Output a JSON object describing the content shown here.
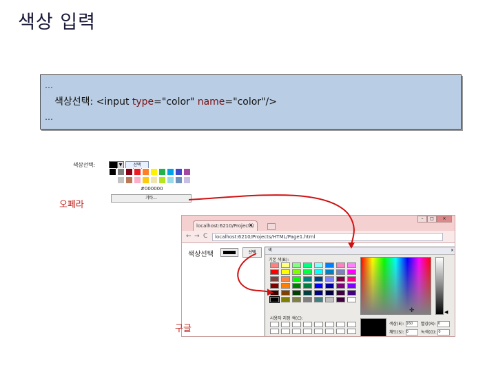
{
  "slide_title": "색상 입력",
  "code_box": {
    "ellipsis_top": "…",
    "label": "색상선택: ",
    "tag_open": "<input ",
    "attr1_name": "type",
    "attr1_eq": "=\"",
    "attr1_value": "color",
    "attr1_close": "\" ",
    "attr2_name": "name",
    "attr2_eq": "=\"",
    "attr2_value": "color",
    "tag_close": "\"/>",
    "ellipsis_bottom": "…"
  },
  "opera_picker": {
    "label": "색상선택:",
    "dropdown_arrow": "▼",
    "button_label": "선택",
    "hex_value": "#000000",
    "other_button": "기타...",
    "swatches": [
      "#000000",
      "#7f7f7f",
      "#880015",
      "#ed1c24",
      "#ff7f27",
      "#fff200",
      "#22b14c",
      "#00a2e8",
      "#3f48cc",
      "#a349a4",
      "#ffffff",
      "#c3c3c3",
      "#b97a57",
      "#ffaec9",
      "#ffc90e",
      "#efe4b0",
      "#b5e61d",
      "#99d9ea",
      "#7092be",
      "#c8bfe7"
    ]
  },
  "caption_opera": "오페라",
  "caption_google": "구글",
  "chrome": {
    "tab_title": "localhost:6210/Projects/",
    "tab_close": "×",
    "win_controls": [
      "–",
      "□",
      "×"
    ],
    "nav_back": "←",
    "nav_forward": "→",
    "nav_reload": "C",
    "address": "localhost:6210/Projects/HTML/Page1.html",
    "page_label": "색상선택",
    "picker_button": "선택",
    "dialog": {
      "title": "색",
      "close": "×",
      "basic_colors_label": "기본 색(B):",
      "custom_colors_label": "사용자 지정 색(C):",
      "basic_colors": [
        "#ff8080",
        "#ffff80",
        "#80ff80",
        "#00ff80",
        "#80ffff",
        "#0080ff",
        "#ff80c0",
        "#ff80ff",
        "#ff0000",
        "#ffff00",
        "#80ff00",
        "#00ff40",
        "#00ffff",
        "#0080c0",
        "#8080c0",
        "#ff00ff",
        "#804040",
        "#ff8040",
        "#00ff00",
        "#008080",
        "#004080",
        "#8080ff",
        "#800040",
        "#ff0080",
        "#800000",
        "#ff8000",
        "#008000",
        "#008040",
        "#0000ff",
        "#0000a0",
        "#800080",
        "#8000ff",
        "#400000",
        "#804000",
        "#004000",
        "#004040",
        "#000080",
        "#000040",
        "#400040",
        "#400080",
        "#000000",
        "#808000",
        "#808040",
        "#808080",
        "#408080",
        "#c0c0c0",
        "#400040",
        "#ffffff"
      ],
      "fields": {
        "hue_label": "색상(E):",
        "hue_value": "160",
        "red_label": "빨강(R):",
        "red_value": "0",
        "sat_label": "채도(S):",
        "sat_value": "0",
        "green_label": "녹색(G):",
        "green_value": "0"
      }
    }
  }
}
